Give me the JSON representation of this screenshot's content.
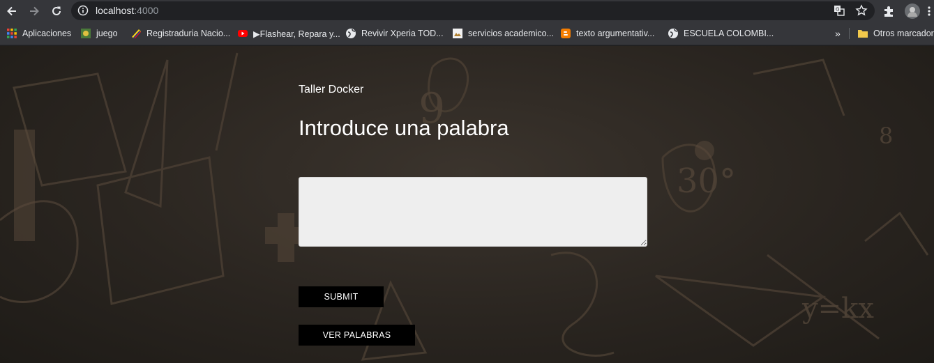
{
  "browser": {
    "url_host": "localhost",
    "url_port": ":4000",
    "bookmarks": [
      {
        "label": "Aplicaciones",
        "icon": "apps-grid-icon"
      },
      {
        "label": "juego",
        "icon": "globe-favicon-icon"
      },
      {
        "label": "Registraduria Nacio...",
        "icon": "flag-favicon-icon"
      },
      {
        "label": "▶Flashear, Repara y...",
        "icon": "youtube-icon"
      },
      {
        "label": "Revivir Xperia TOD...",
        "icon": "globe-icon"
      },
      {
        "label": "servicios academico...",
        "icon": "image-favicon-icon"
      },
      {
        "label": "texto argumentativ...",
        "icon": "blogger-icon"
      },
      {
        "label": "ESCUELA COLOMBI...",
        "icon": "globe-icon"
      }
    ],
    "more_bookmarks": "»",
    "other_bookmarks": "Otros marcadores"
  },
  "page": {
    "subtitle": "Taller Docker",
    "title": "Introduce una palabra",
    "input_value": "",
    "submit_label": "SUBMIT",
    "ver_label": "VER PALABRAS"
  },
  "colors": {
    "chrome": "#35363a",
    "omnibox": "#202124",
    "button": "#000000",
    "input_bg": "#eeeeee"
  }
}
